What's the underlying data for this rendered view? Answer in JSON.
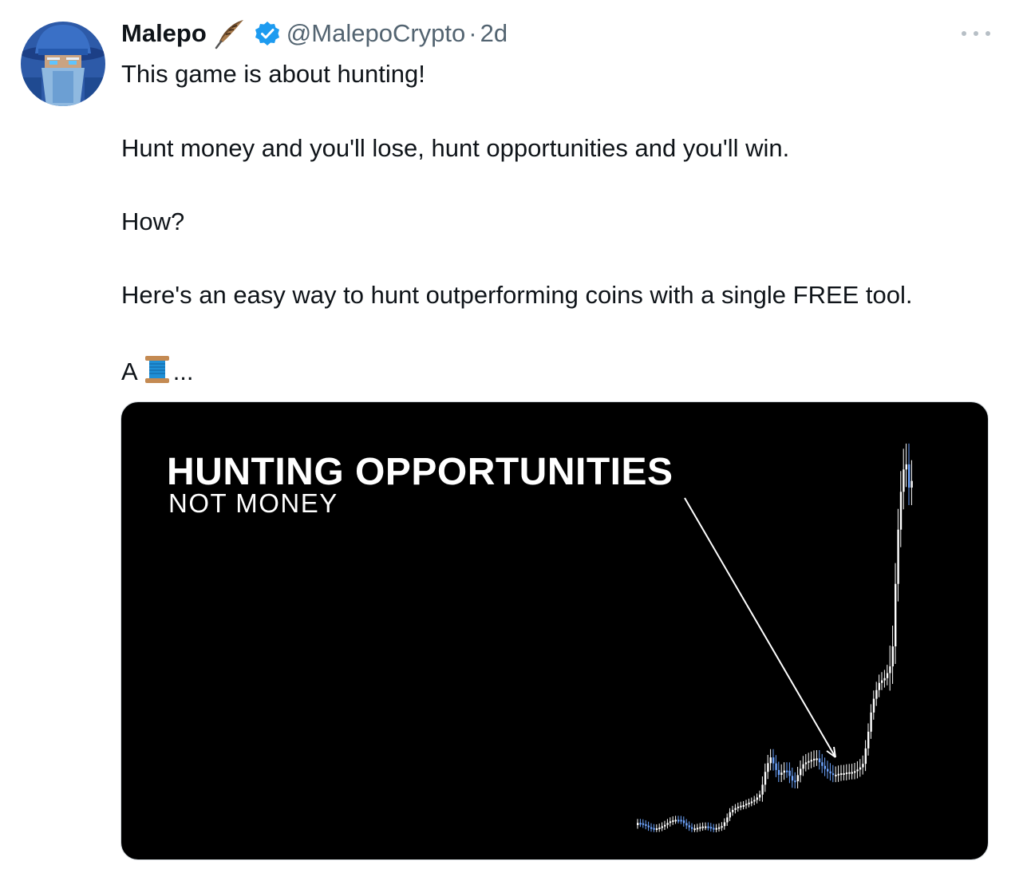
{
  "tweet": {
    "author_name": "Malepo",
    "handle": "@MalepoCrypto",
    "separator": "·",
    "time": "2d",
    "lines": [
      "This game is about hunting!",
      "Hunt money and you'll lose, hunt opportunities and you'll win.",
      "How?",
      "Here's an easy way to hunt outperforming coins with a single FREE tool.",
      "A",
      "..."
    ]
  },
  "icons": {
    "avatar": "wizard-avatar",
    "name_emoji": "feather-icon",
    "verified": "verified-badge-icon",
    "more": "more-options-icon",
    "thread": "spool-of-thread-icon"
  },
  "colors": {
    "verified": "#1d9bf0",
    "candle_up": "#ffffff",
    "candle_down": "#6ea5ff"
  },
  "media": {
    "title": "HUNTING OPPORTUNITIES",
    "subtitle": "NOT MONEY"
  }
}
